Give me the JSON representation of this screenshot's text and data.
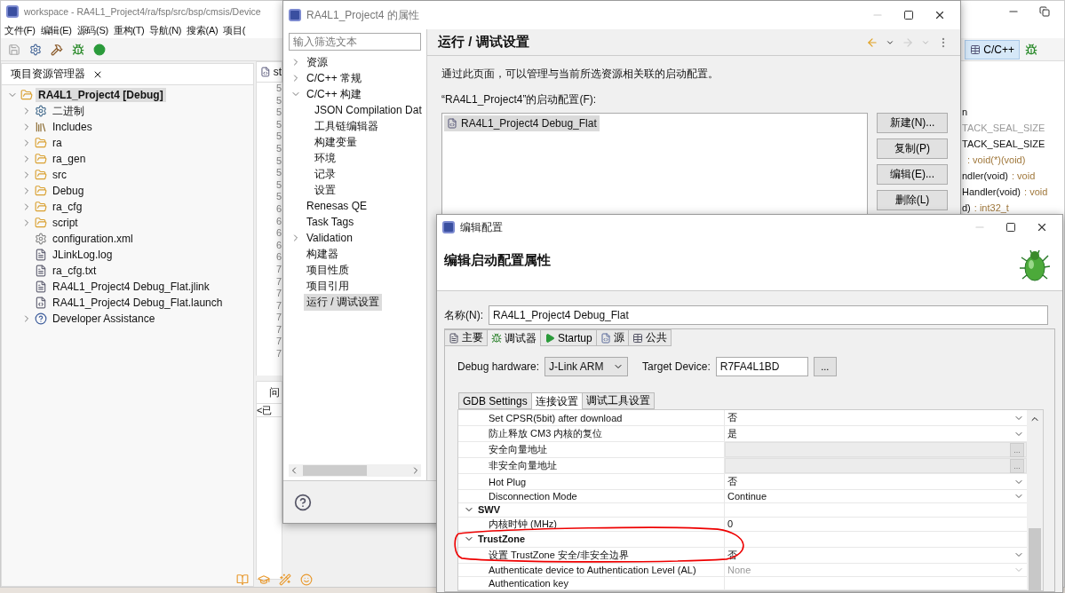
{
  "ide": {
    "title": "workspace - RA4L1_Project4/ra/fsp/src/bsp/cmsis/Device",
    "menu": [
      "文件(F)",
      "编辑(E)",
      "源码(S)",
      "重构(T)",
      "导航(N)",
      "搜索(A)",
      "项目("
    ],
    "explorer": {
      "title": "项目资源管理器",
      "tree": [
        {
          "label": "RA4L1_Project4 [Debug]",
          "kind": "project",
          "expanded": true,
          "selected": true,
          "children": [
            {
              "label": "二进制",
              "kind": "binaries",
              "expanded": false,
              "selected": false
            },
            {
              "label": "Includes",
              "kind": "includes",
              "expanded": false,
              "selected": false
            },
            {
              "label": "ra",
              "kind": "source-folder",
              "expanded": false,
              "selected": false
            },
            {
              "label": "ra_gen",
              "kind": "source-folder",
              "expanded": false,
              "selected": false
            },
            {
              "label": "src",
              "kind": "source-folder",
              "expanded": false,
              "selected": false
            },
            {
              "label": "Debug",
              "kind": "folder",
              "expanded": false,
              "selected": false
            },
            {
              "label": "ra_cfg",
              "kind": "folder",
              "expanded": false,
              "selected": false
            },
            {
              "label": "script",
              "kind": "folder",
              "expanded": false,
              "selected": false
            },
            {
              "label": "configuration.xml",
              "kind": "settings-file",
              "selected": false
            },
            {
              "label": "JLinkLog.log",
              "kind": "text-file",
              "selected": false
            },
            {
              "label": "ra_cfg.txt",
              "kind": "text-file",
              "selected": false
            },
            {
              "label": "RA4L1_Project4 Debug_Flat.jlink",
              "kind": "text-file",
              "selected": false
            },
            {
              "label": "RA4L1_Project4 Debug_Flat.launch",
              "kind": "launch-file",
              "selected": false
            },
            {
              "label": "Developer Assistance",
              "kind": "help",
              "expanded": false,
              "selected": false
            }
          ]
        }
      ]
    },
    "editor": {
      "tab": "st",
      "line_numbers": [
        "5",
        "5",
        "5",
        "5",
        "5",
        "5",
        "5",
        "5",
        "5",
        "5",
        "6",
        "6",
        "6",
        "6",
        "6",
        "7",
        "7",
        "7",
        "7",
        "7",
        "7",
        "7",
        "7"
      ]
    },
    "problems": {
      "tab": "问",
      "row": "<已"
    },
    "perspective": "C/C++",
    "outline": [
      {
        "name": "n",
        "dim": false
      },
      {
        "name": "TACK_SEAL_SIZE",
        "dim": true
      },
      {
        "name": "TACK_SEAL_SIZE",
        "dim": false
      },
      {
        "type": ": void(*)(void)"
      },
      {
        "name": "ndler(void)",
        "type": ": void",
        "dim": false
      },
      {
        "name": "Handler(void)",
        "type": ": void",
        "dim": false
      },
      {
        "name": "d)",
        "type": ": int32_t",
        "dim": false
      }
    ]
  },
  "properties": {
    "title": "RA4L1_Project4 的属性",
    "filter_placeholder": "输入筛选文本",
    "tree": [
      {
        "label": "资源",
        "expanded": false,
        "selected": false
      },
      {
        "label": "C/C++ 常规",
        "expanded": false,
        "selected": false
      },
      {
        "label": "C/C++ 构建",
        "expanded": true,
        "selected": false,
        "children": [
          {
            "label": "JSON Compilation Dat",
            "selected": false
          },
          {
            "label": "工具链编辑器",
            "selected": false
          },
          {
            "label": "构建变量",
            "selected": false
          },
          {
            "label": "环境",
            "selected": false
          },
          {
            "label": "记录",
            "selected": false
          },
          {
            "label": "设置",
            "selected": false
          }
        ]
      },
      {
        "label": "Renesas QE",
        "selected": false
      },
      {
        "label": "Task Tags",
        "selected": false
      },
      {
        "label": "Validation",
        "expanded": false,
        "selected": false
      },
      {
        "label": "构建器",
        "selected": false
      },
      {
        "label": "项目性质",
        "selected": false
      },
      {
        "label": "项目引用",
        "selected": false
      },
      {
        "label": "运行 / 调试设置",
        "selected": true
      }
    ],
    "page_title": "运行 / 调试设置",
    "description": "通过此页面，可以管理与当前所选资源相关联的启动配置。",
    "configs_label": "“RA4L1_Project4”的启动配置(F):",
    "configs": [
      {
        "label": "RA4L1_Project4 Debug_Flat",
        "selected": true
      }
    ],
    "buttons": [
      "新建(N)...",
      "复制(P)",
      "编辑(E)...",
      "删除(L)"
    ]
  },
  "edit_dialog": {
    "title": "编辑配置",
    "header": "编辑启动配置属性",
    "name_label": "名称(N):",
    "name_value": "RA4L1_Project4 Debug_Flat",
    "tabs": [
      {
        "label": "主要",
        "kind": "main",
        "selected": false
      },
      {
        "label": "调试器",
        "kind": "debugger",
        "selected": true
      },
      {
        "label": "Startup",
        "kind": "startup",
        "selected": false
      },
      {
        "label": "源",
        "kind": "source",
        "selected": false
      },
      {
        "label": "公共",
        "kind": "common",
        "selected": false
      }
    ],
    "hardware_label": "Debug hardware:",
    "hardware_value": "J-Link ARM",
    "device_label": "Target Device:",
    "device_value": "R7FA4L1BD",
    "device_browse": "...",
    "subtabs": [
      {
        "label": "GDB Settings",
        "selected": false
      },
      {
        "label": "连接设置",
        "selected": true
      },
      {
        "label": "调试工具设置",
        "selected": false
      }
    ],
    "groups": [
      {
        "rows": [
          {
            "label": "Set CPSR(5bit) after download",
            "value": "否",
            "kind": "dropdown",
            "disabled": false
          },
          {
            "label": "防止释放 CM3 内核的复位",
            "value": "是",
            "kind": "dropdown",
            "disabled": false
          },
          {
            "label": "安全向量地址",
            "browse": "...",
            "kind": "browse",
            "disabled": true
          },
          {
            "label": "非安全向量地址",
            "browse": "...",
            "kind": "browse",
            "disabled": true
          },
          {
            "label": "Hot Plug",
            "value": "否",
            "kind": "dropdown",
            "disabled": false
          },
          {
            "label": "Disconnection Mode",
            "value": "Continue",
            "kind": "dropdown",
            "disabled": false
          }
        ]
      },
      {
        "label": "SWV",
        "expanded": true,
        "circled": false,
        "rows": [
          {
            "label": "内核时钟 (MHz)",
            "value": "0",
            "kind": "text",
            "disabled": false
          }
        ]
      },
      {
        "label": "TrustZone",
        "expanded": true,
        "circled": true,
        "rows": [
          {
            "label": "设置 TrustZone 安全/非安全边界",
            "value": "否",
            "kind": "dropdown",
            "disabled": false
          },
          {
            "label": "Authenticate device to Authentication Level (AL)",
            "value": "None",
            "kind": "dropdown",
            "disabled": true
          },
          {
            "label": "Authentication key",
            "kind": "text"
          }
        ]
      }
    ]
  }
}
